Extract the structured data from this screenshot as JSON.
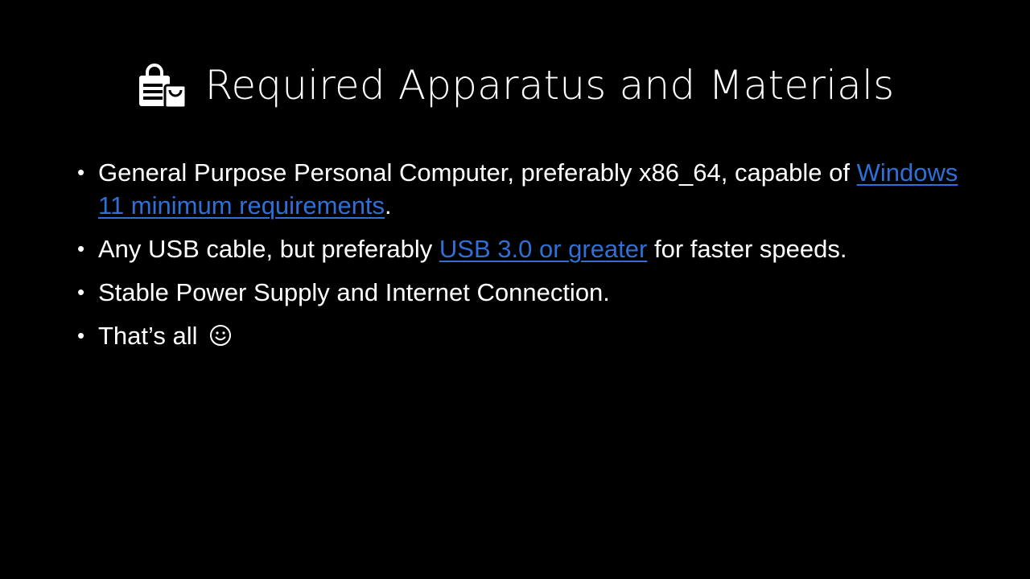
{
  "slide": {
    "title": "Required Apparatus and Materials",
    "title_icon": "shopping-bag-icon",
    "bullets": [
      {
        "text_before": "General Purpose Personal Computer, preferably x86_64, capable of ",
        "link": "Windows 11 minimum requirements",
        "text_after": "."
      },
      {
        "text_before": "Any USB cable, but preferably ",
        "link": "USB 3.0 or greater",
        "text_after": " for faster speeds."
      },
      {
        "text": "Stable Power Supply and Internet Connection."
      },
      {
        "text": "That’s all ",
        "icon": "smiley-face-icon"
      }
    ],
    "bullet_char": "•",
    "colors": {
      "background": "#000000",
      "text": "#ffffff",
      "link": "#2f6fd6"
    }
  }
}
